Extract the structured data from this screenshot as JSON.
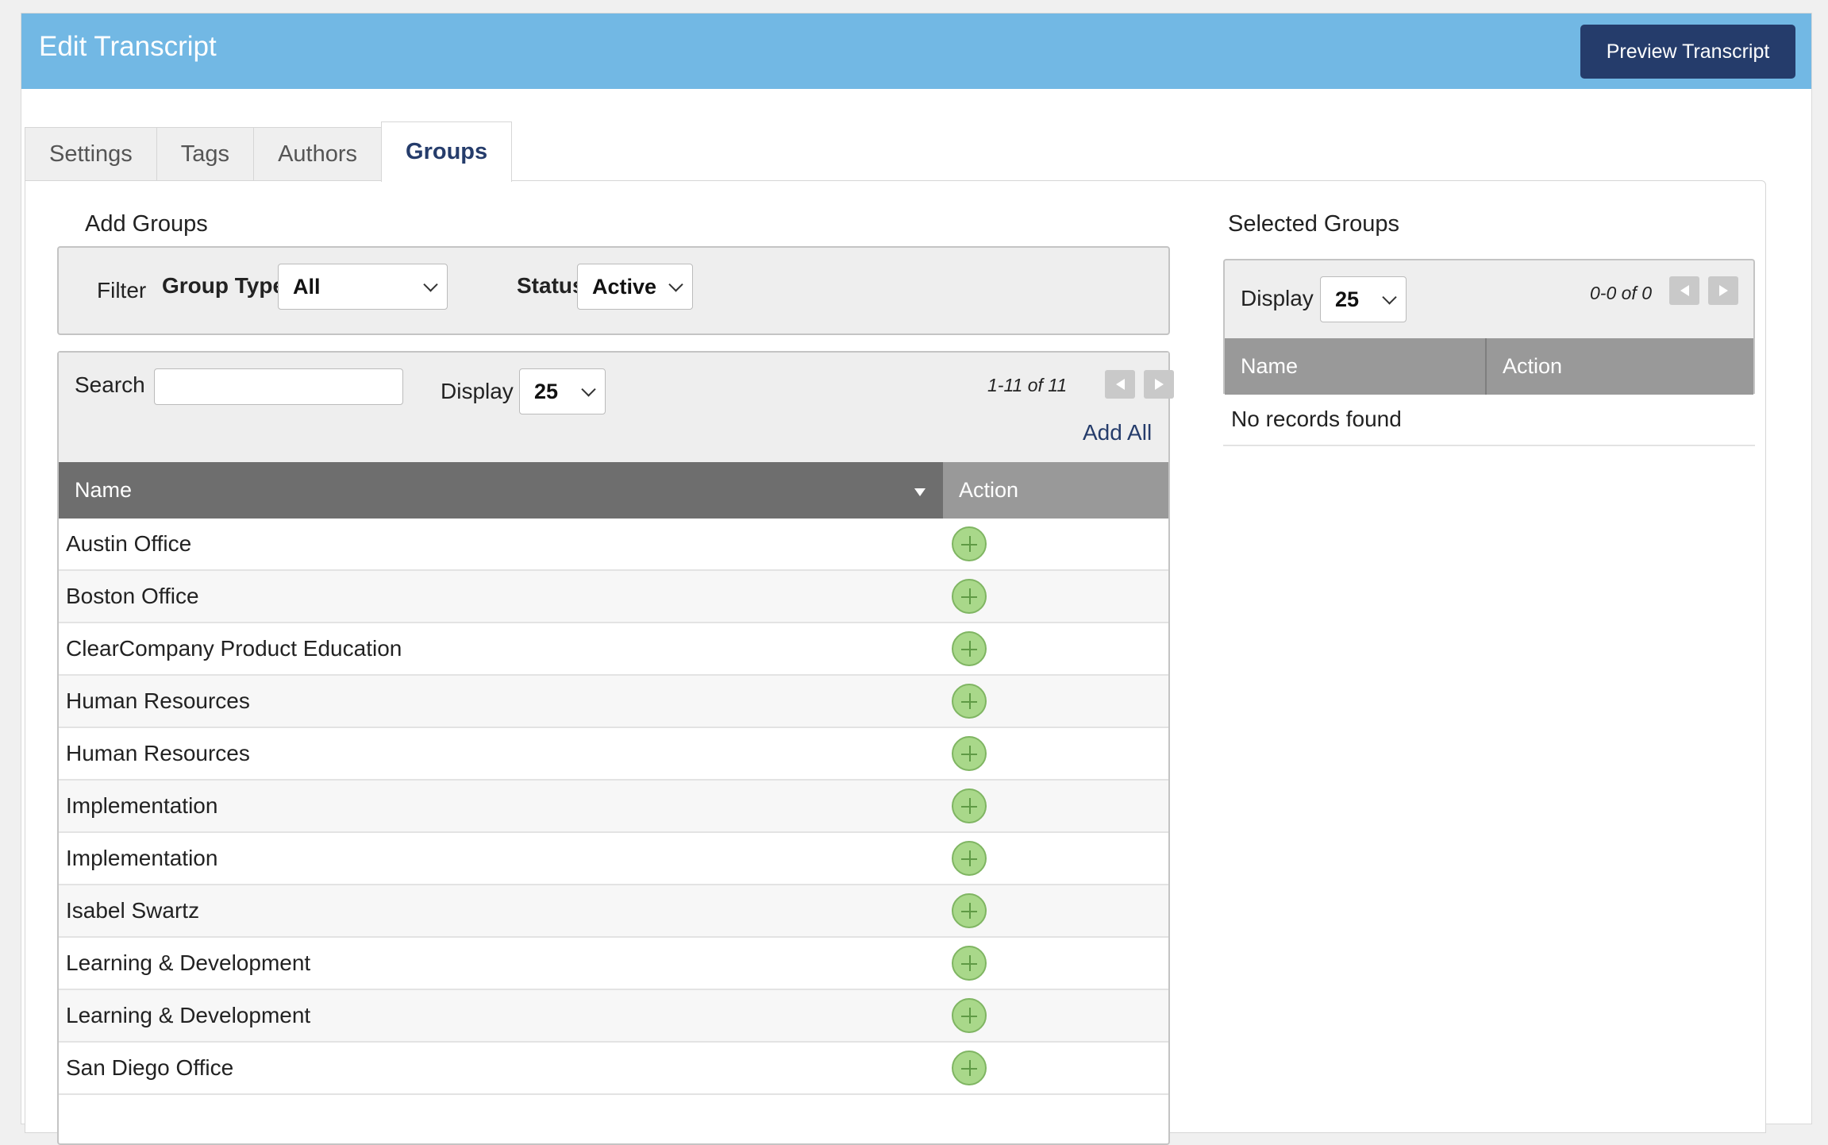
{
  "header": {
    "title": "Edit Transcript",
    "preview_button": "Preview Transcript"
  },
  "tabs": [
    {
      "label": "Settings",
      "active": false
    },
    {
      "label": "Tags",
      "active": false
    },
    {
      "label": "Authors",
      "active": false
    },
    {
      "label": "Groups",
      "active": true
    }
  ],
  "add_groups": {
    "title": "Add Groups",
    "filter": {
      "label": "Filter",
      "group_type_label": "Group Type",
      "group_type_value": "All",
      "status_label": "Status",
      "status_value": "Active"
    },
    "search_label": "Search",
    "search_value": "",
    "display_label": "Display",
    "display_value": "25",
    "pager_text": "1-11 of 11",
    "add_all_label": "Add All",
    "columns": [
      "Name",
      "Action"
    ],
    "rows": [
      "Austin Office",
      "Boston Office",
      "ClearCompany Product Education",
      "Human Resources",
      "Human Resources",
      "Implementation",
      "Implementation",
      "Isabel Swartz",
      "Learning & Development",
      "Learning & Development",
      "San Diego Office"
    ]
  },
  "selected_groups": {
    "title": "Selected Groups",
    "display_label": "Display",
    "display_value": "25",
    "pager_text": "0-0 of 0",
    "columns": [
      "Name",
      "Action"
    ],
    "empty_text": "No records found"
  },
  "colors": {
    "header_bg": "#72b8e4",
    "primary_button": "#253c6b",
    "table_header_dark": "#6e6e6e",
    "table_header_light": "#999999",
    "add_icon": "#a9d88a"
  }
}
